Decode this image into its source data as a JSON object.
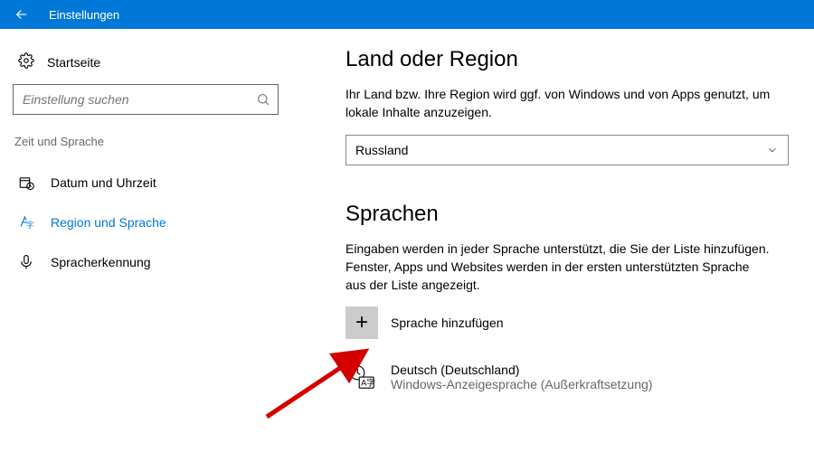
{
  "titlebar": {
    "title": "Einstellungen"
  },
  "sidebar": {
    "home": "Startseite",
    "search_placeholder": "Einstellung suchen",
    "category": "Zeit und Sprache",
    "items": [
      {
        "label": "Datum und Uhrzeit"
      },
      {
        "label": "Region und Sprache"
      },
      {
        "label": "Spracherkennung"
      }
    ]
  },
  "main": {
    "region": {
      "heading": "Land oder Region",
      "desc": "Ihr Land bzw. Ihre Region wird ggf. von Windows und von Apps genutzt, um lokale Inhalte anzuzeigen.",
      "selected": "Russland"
    },
    "languages": {
      "heading": "Sprachen",
      "desc": "Eingaben werden in jeder Sprache unterstützt, die Sie der Liste hinzufügen. Fenster, Apps und Websites werden in der ersten unterstützten Sprache aus der Liste angezeigt.",
      "add_label": "Sprache hinzufügen",
      "items": [
        {
          "name": "Deutsch (Deutschland)",
          "sub": "Windows-Anzeigesprache (Außerkraftsetzung)"
        }
      ]
    }
  }
}
